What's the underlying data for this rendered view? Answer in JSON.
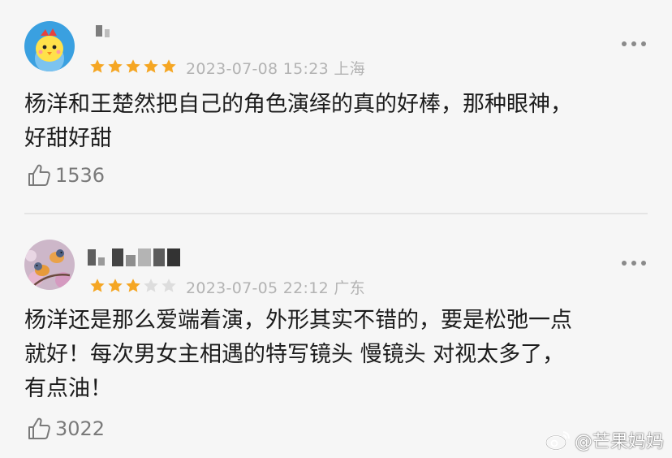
{
  "colors": {
    "star_filled": "#f5a623",
    "star_empty": "#dddddd",
    "meta_text": "#b3b3b3",
    "background": "#f6f6f6"
  },
  "reviews": [
    {
      "rating": 5,
      "max_rating": 5,
      "date": "2023-07-08 15:23",
      "location": "上海",
      "content_lines": [
        "杨洋和王楚然把自己的角色演绎的真的好棒，那种眼神，",
        "好甜好甜"
      ],
      "likes": "1536",
      "avatar_icon": "cartoon-chick-avatar"
    },
    {
      "rating": 3,
      "max_rating": 5,
      "date": "2023-07-05 22:12",
      "location": "广东",
      "content_lines": [
        "杨洋还是那么爱端着演，外形其实不错的，要是松弛一点",
        "就好！每次男女主相遇的特写镜头 慢镜头 对视太多了，",
        "有点油！"
      ],
      "likes": "3022",
      "avatar_icon": "bird-on-blossom-avatar"
    }
  ],
  "watermark": {
    "platform_icon": "weibo-icon",
    "text": "@芒果妈妈"
  }
}
